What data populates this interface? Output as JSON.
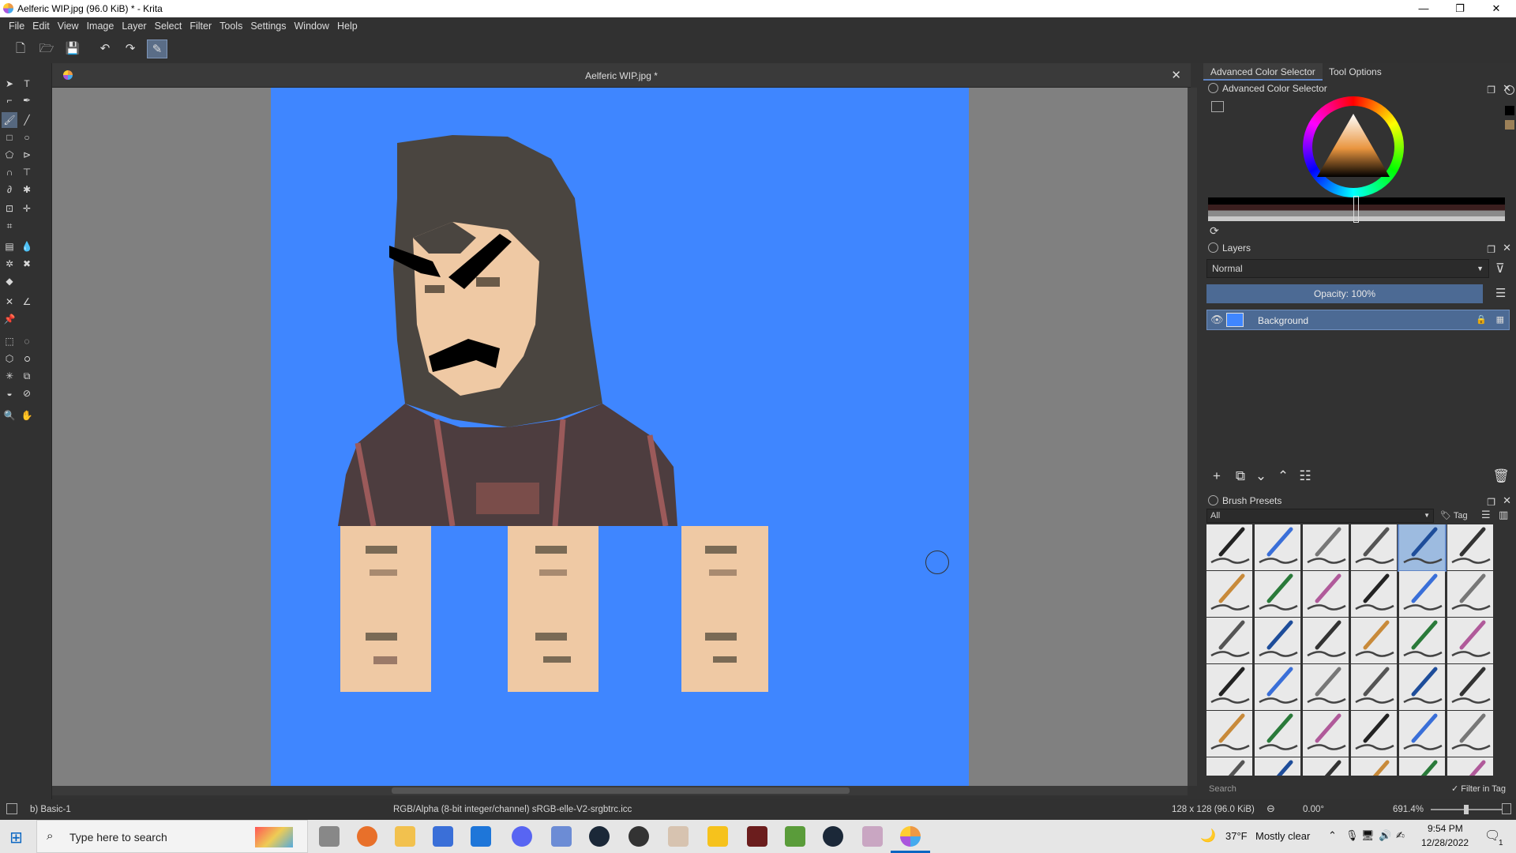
{
  "window": {
    "title": "Aelferic WIP.jpg (96.0 KiB)  * - Krita",
    "minimize": "—",
    "maximize": "❐",
    "close": "✕"
  },
  "menu": [
    "File",
    "Edit",
    "View",
    "Image",
    "Layer",
    "Select",
    "Filter",
    "Tools",
    "Settings",
    "Window",
    "Help"
  ],
  "document": {
    "tab_title": "Aelferic WIP.jpg *",
    "close": "✕",
    "canvas_color": "#3f86ff"
  },
  "dockers": {
    "tabs": [
      "Advanced Color Selector",
      "Tool Options"
    ],
    "color_selector": {
      "title": "Advanced Color Selector"
    },
    "layers": {
      "title": "Layers",
      "blend_mode": "Normal",
      "opacity": "Opacity:  100%",
      "items": [
        {
          "name": "Background"
        }
      ]
    },
    "brush_presets": {
      "title": "Brush Presets",
      "filter": "All",
      "tag": "Tag",
      "search_placeholder": "Search",
      "filter_in_tag": "Filter in Tag"
    }
  },
  "status": {
    "brush": "b) Basic-1",
    "color_profile": "RGB/Alpha (8-bit integer/channel)  sRGB-elle-V2-srgbtrc.icc",
    "image_size": "128 x 128 (96.0 KiB)",
    "rotation": "0.00°",
    "zoom": "691.4%"
  },
  "taskbar": {
    "search_placeholder": "Type here to search",
    "weather_temp": "37°F",
    "weather_text": "Mostly clear",
    "time": "9:54 PM",
    "date": "12/28/2022",
    "notifications": "1"
  }
}
